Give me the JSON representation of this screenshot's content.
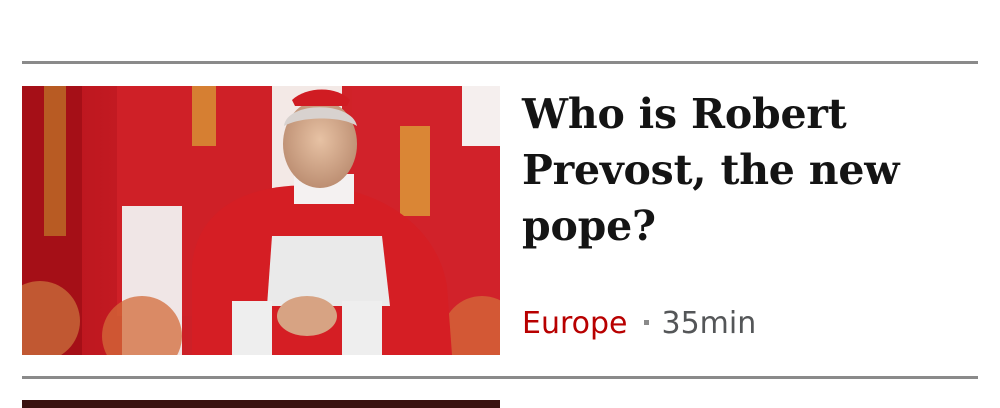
{
  "story": {
    "headline": "Who is Robert Prevost, the new pope?",
    "section": "Europe",
    "time": "35min",
    "image_alt": "Robert Prevost in red cardinal robes",
    "colors": {
      "section": "#b80000",
      "time": "#545658",
      "headline": "#141414",
      "divider": "#8a8a8a"
    }
  },
  "next_story": {
    "image_alt": ""
  }
}
